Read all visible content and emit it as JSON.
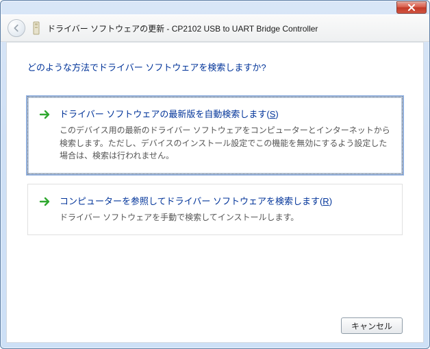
{
  "window": {
    "title": "ドライバー ソフトウェアの更新 - CP2102 USB to UART Bridge Controller"
  },
  "prompt": "どのような方法でドライバー ソフトウェアを検索しますか?",
  "options": [
    {
      "title_pre": "ドライバー ソフトウェアの最新版を自動検索します(",
      "accel": "S",
      "title_post": ")",
      "desc": "このデバイス用の最新のドライバー ソフトウェアをコンピューターとインターネットから検索します。ただし、デバイスのインストール設定でこの機能を無効にするよう設定した場合は、検索は行われません。"
    },
    {
      "title_pre": "コンピューターを参照してドライバー ソフトウェアを検索します(",
      "accel": "R",
      "title_post": ")",
      "desc": "ドライバー ソフトウェアを手動で検索してインストールします。"
    }
  ],
  "buttons": {
    "cancel": "キャンセル"
  }
}
